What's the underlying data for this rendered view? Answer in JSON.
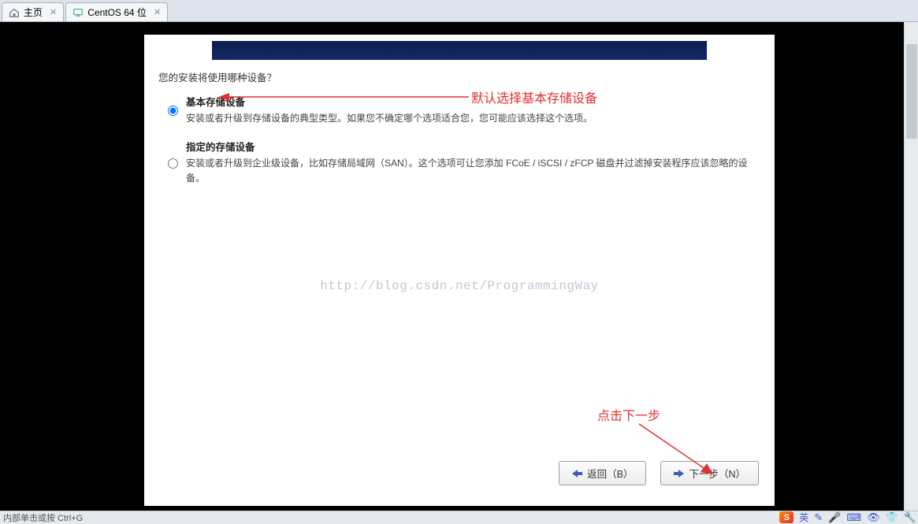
{
  "tabs": {
    "home": "主页",
    "vm": "CentOS 64 位"
  },
  "installer": {
    "question": "您的安装将使用哪种设备？",
    "option_basic": {
      "title": "基本存储设备",
      "desc": "安装或者升级到存储设备的典型类型。如果您不确定哪个选项适合您，您可能应该选择这个选项。"
    },
    "option_specified": {
      "title": "指定的存储设备",
      "desc": "安装或者升级到企业级设备，比如存储局域网（SAN）。这个选项可让您添加 FCoE / iSCSI / zFCP 磁盘并过滤掉安装程序应该忽略的设备。"
    },
    "watermark": "http://blog.csdn.net/ProgrammingWay",
    "back_label": "返回（B）",
    "next_label": "下一步（N）"
  },
  "annotations": {
    "default_basic": "默认选择基本存储设备",
    "click_next": "点击下一步"
  },
  "status": {
    "left_hint": "内部单击或按 Ctrl+G",
    "ime_label": "英",
    "sogou_label": "S"
  }
}
